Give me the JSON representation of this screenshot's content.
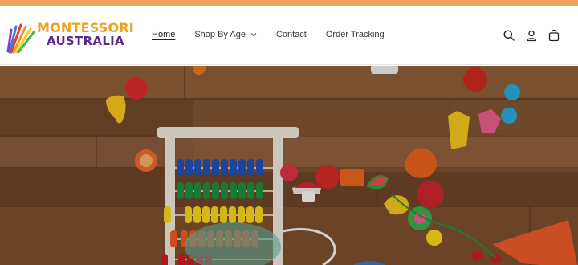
{
  "brand": {
    "line1": "MONTESSORI",
    "line2": "AUSTRALIA",
    "accent_orange": "#f0a020",
    "accent_purple": "#5a2a8c"
  },
  "announcement_bar": {
    "color": "#f0a15e"
  },
  "nav": {
    "items": [
      {
        "label": "Home",
        "active": true
      },
      {
        "label": "Shop By Age",
        "has_dropdown": true
      },
      {
        "label": "Contact"
      },
      {
        "label": "Order Tracking"
      }
    ]
  },
  "header_icons": [
    "search-icon",
    "account-icon",
    "cart-icon"
  ],
  "hero": {
    "image": "toys-on-wooden-floor",
    "palette": {
      "wood": "#8a5a34",
      "wood_dark": "#5e3a1f"
    }
  }
}
